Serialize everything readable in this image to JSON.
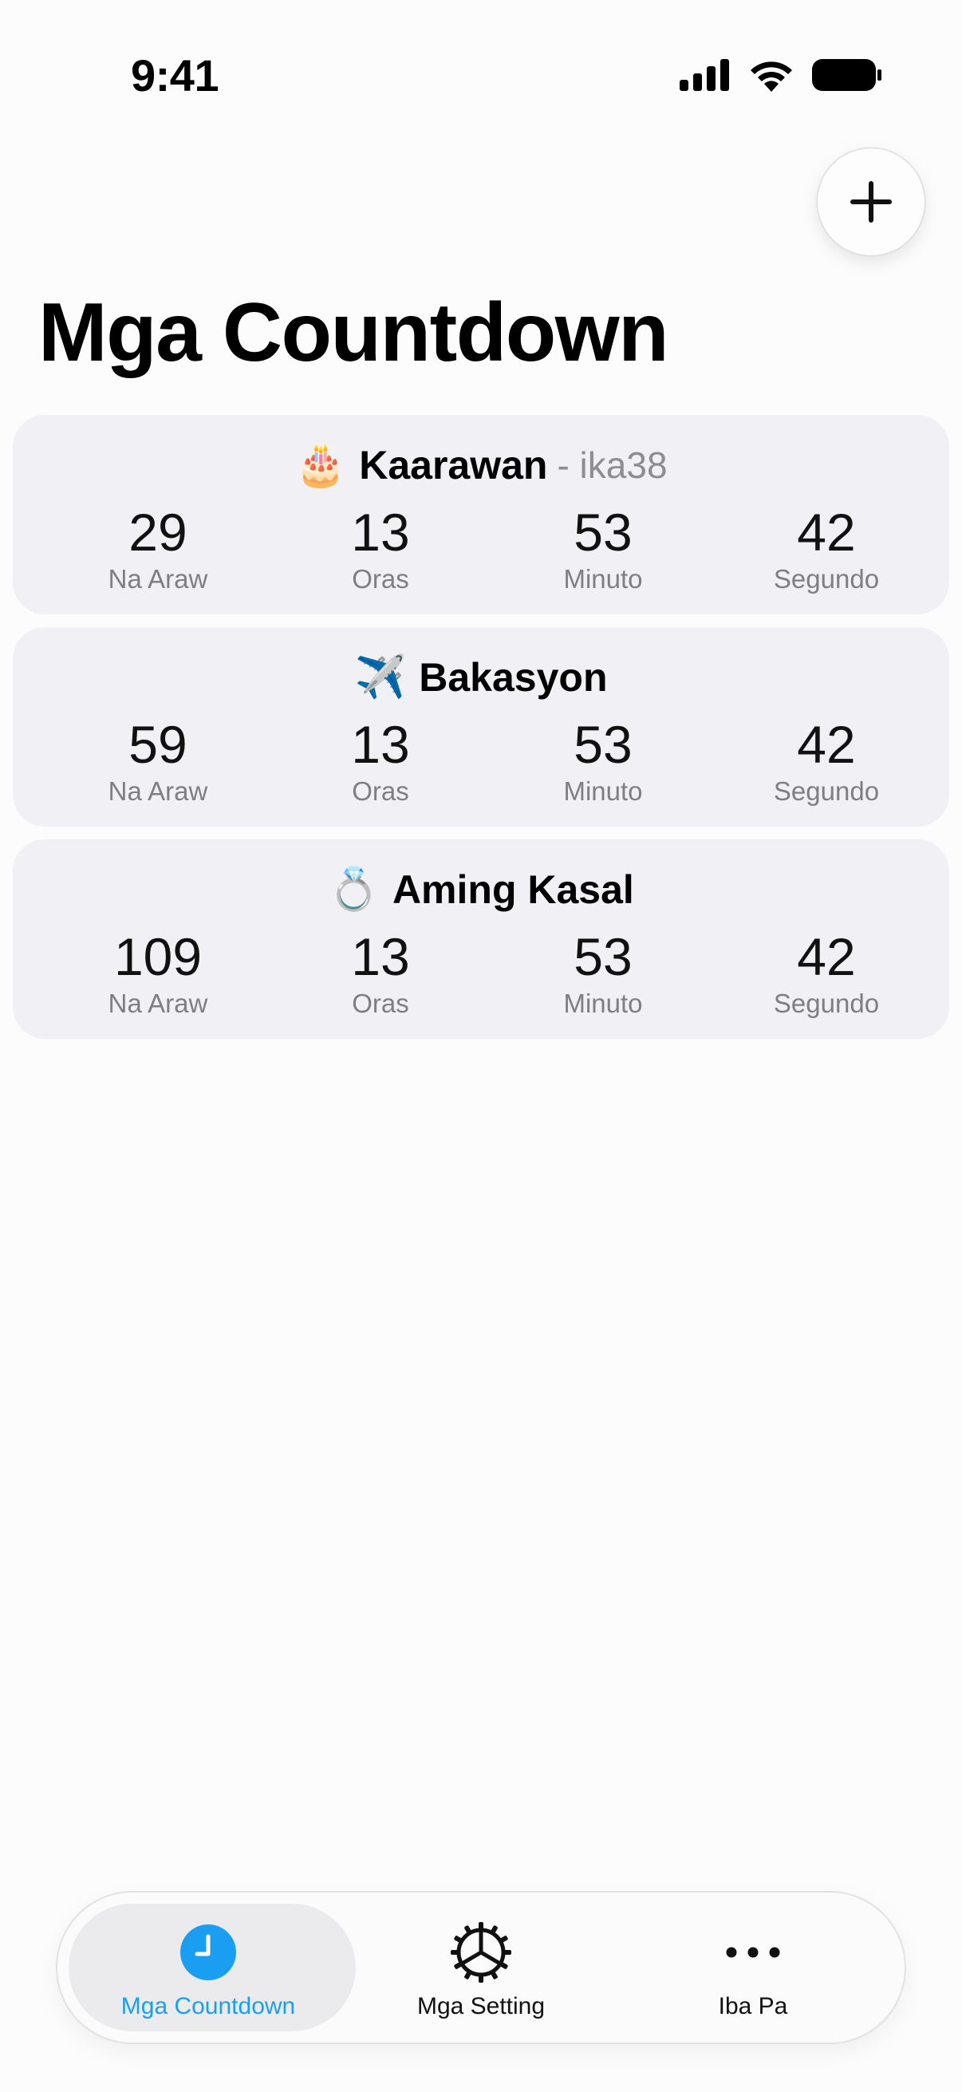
{
  "status_bar": {
    "time": "9:41"
  },
  "header": {
    "add_label": "+",
    "title": "Mga Countdown"
  },
  "countdowns": [
    {
      "emoji": "🎂",
      "title": "Kaarawan",
      "subtitle": "- ika38",
      "units": [
        {
          "value": "29",
          "label": "Na Araw"
        },
        {
          "value": "13",
          "label": "Oras"
        },
        {
          "value": "53",
          "label": "Minuto"
        },
        {
          "value": "42",
          "label": "Segundo"
        }
      ]
    },
    {
      "emoji": "✈️",
      "title": "Bakasyon",
      "subtitle": "",
      "units": [
        {
          "value": "59",
          "label": "Na Araw"
        },
        {
          "value": "13",
          "label": "Oras"
        },
        {
          "value": "53",
          "label": "Minuto"
        },
        {
          "value": "42",
          "label": "Segundo"
        }
      ]
    },
    {
      "emoji": "💍",
      "title": "Aming Kasal",
      "subtitle": "",
      "units": [
        {
          "value": "109",
          "label": "Na Araw"
        },
        {
          "value": "13",
          "label": "Oras"
        },
        {
          "value": "53",
          "label": "Minuto"
        },
        {
          "value": "42",
          "label": "Segundo"
        }
      ]
    }
  ],
  "tabbar": {
    "accent": "#1a9ef2",
    "tabs": [
      {
        "label": "Mga Countdown",
        "icon": "clock-icon",
        "active": true
      },
      {
        "label": "Mga Setting",
        "icon": "gear-icon",
        "active": false
      },
      {
        "label": "Iba Pa",
        "icon": "more-icon",
        "active": false
      }
    ]
  }
}
